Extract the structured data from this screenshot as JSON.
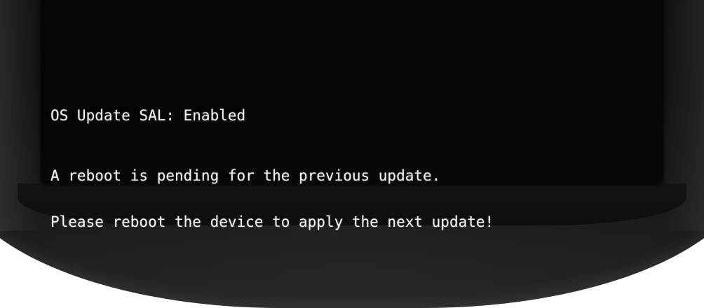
{
  "console": {
    "status_line": "OS Update SAL: Enabled",
    "message_lines": [
      "A reboot is pending for the previous update.",
      "Please reboot the device to apply the next update!"
    ]
  },
  "colors": {
    "background": "#050505",
    "text": "#f4f4f4",
    "bezel": "#121212"
  }
}
